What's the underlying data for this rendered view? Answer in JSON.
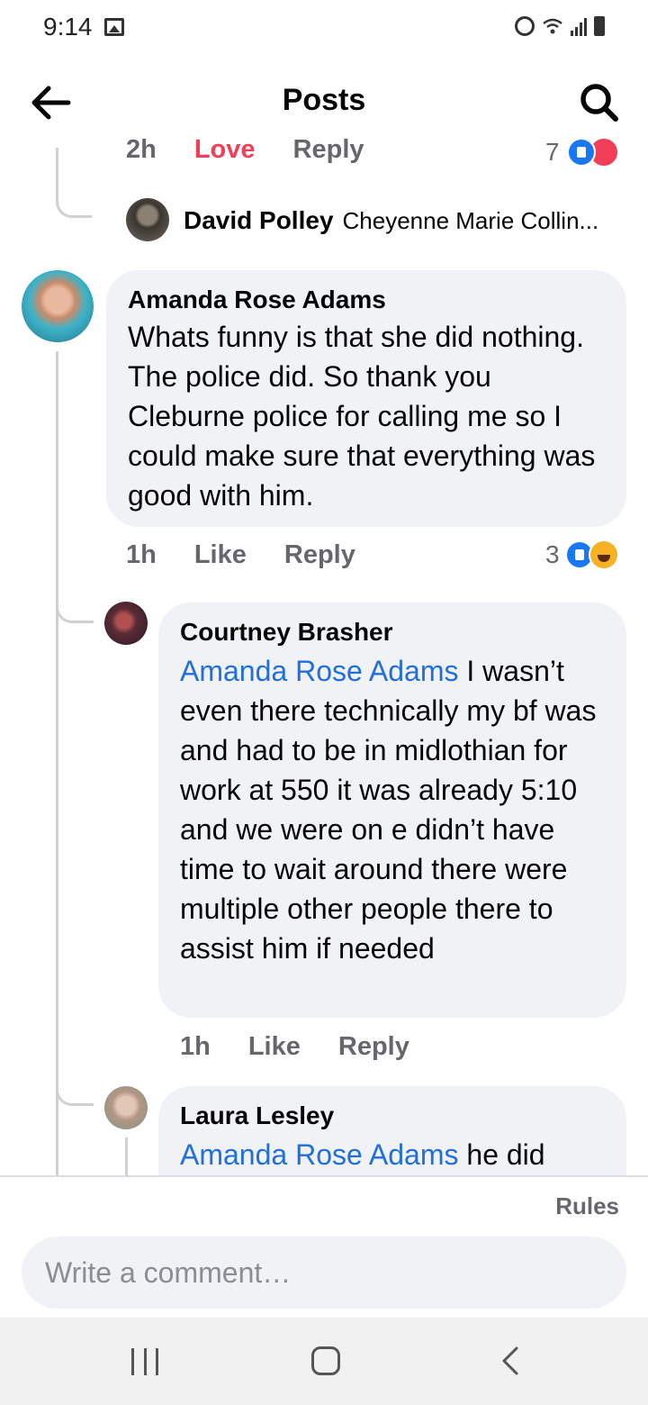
{
  "status_bar": {
    "time": "9:14"
  },
  "header": {
    "title": "Posts"
  },
  "comments": {
    "prev_meta": {
      "time": "2h",
      "love": "Love",
      "reply": "Reply",
      "count": "7"
    },
    "reply_preview": {
      "author": "David Polley",
      "text": "Cheyenne Marie Collin..."
    },
    "main_comment": {
      "author": "Amanda Rose Adams",
      "text": "Whats funny is that she did nothing. The police did. So thank you Cleburne police for calling me so I could make sure that everything was good with him.",
      "time": "1h",
      "like": "Like",
      "reply": "Reply",
      "reaction_count": "3"
    },
    "reply1": {
      "author": "Courtney Brasher",
      "mention": "Amanda Rose Adams",
      "text": " I wasn’t even there technically my bf was and had to be in midlothian for work at 550 it was already 5:10 and we were on e didn’t have time to wait around there were multiple other people there to assist him if needed",
      "time": "1h",
      "like": "Like",
      "reply": "Reply"
    },
    "reply2": {
      "author": "Laura Lesley",
      "mention": "Amanda Rose Adams",
      "text": " he did"
    }
  },
  "footer": {
    "rules": "Rules",
    "comment_placeholder": "Write a comment…"
  },
  "colors": {
    "mention": "#216fdb",
    "bubble": "#f0f2f5",
    "love": "#f33e58",
    "like": "#1877f2"
  }
}
